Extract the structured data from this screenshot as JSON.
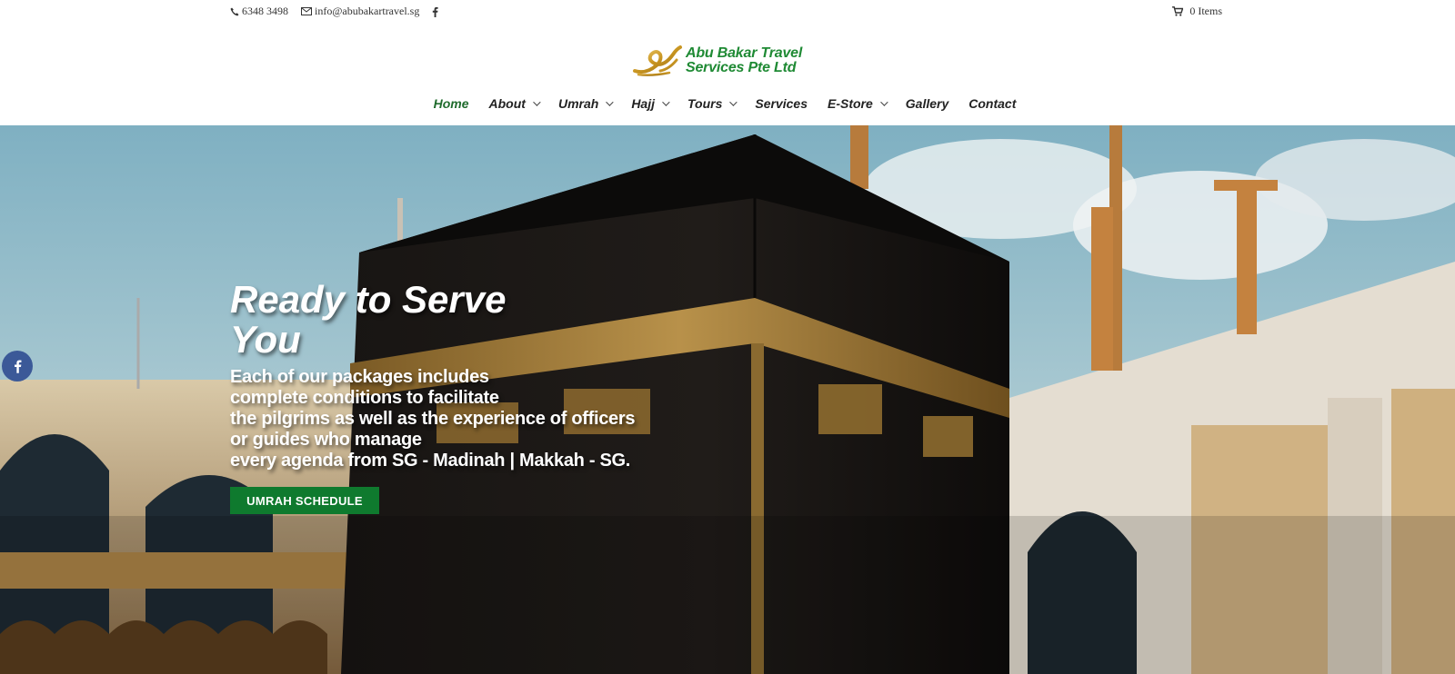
{
  "topbar": {
    "phone": "6348 3498",
    "email": "info@abubakartravel.sg",
    "cart": "0 Items"
  },
  "logo": {
    "line1": "Abu Bakar Travel",
    "line2": "Services Pte Ltd"
  },
  "nav": {
    "items": [
      {
        "label": "Home"
      },
      {
        "label": "About"
      },
      {
        "label": "Umrah"
      },
      {
        "label": "Hajj"
      },
      {
        "label": "Tours"
      },
      {
        "label": "Services"
      },
      {
        "label": "E-Store"
      },
      {
        "label": "Gallery"
      },
      {
        "label": "Contact"
      }
    ]
  },
  "hero": {
    "title": "Ready to Serve You",
    "description": "Each of our packages includes\ncomplete conditions to facilitate\nthe pilgrims as well as the experience of officers\nor guides who manage\nevery agenda from SG - Madinah | Makkah - SG.",
    "button": "UMRAH SCHEDULE"
  },
  "colors": {
    "brand_green": "#1f8a34",
    "button_green": "#0f7a2e",
    "facebook_blue": "#3b5998"
  },
  "icons": [
    "phone-icon",
    "email-icon",
    "facebook-icon",
    "cart-icon"
  ]
}
